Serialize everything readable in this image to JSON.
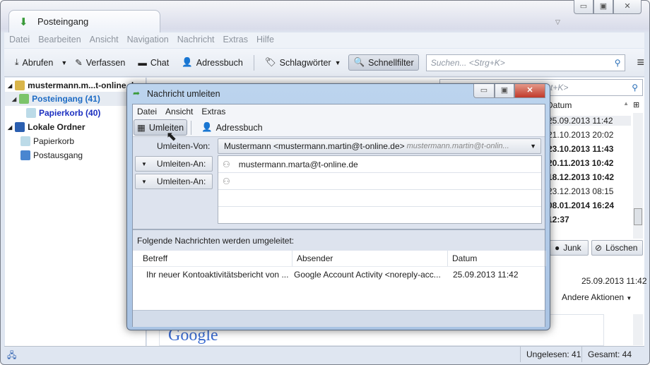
{
  "window": {
    "tab_title": "Posteingang",
    "minimize": "▭",
    "maximize": "▣",
    "close": "✕"
  },
  "menubar": [
    "Datei",
    "Bearbeiten",
    "Ansicht",
    "Navigation",
    "Nachricht",
    "Extras",
    "Hilfe"
  ],
  "toolbar": {
    "abrufen": "Abrufen",
    "verfassen": "Verfassen",
    "chat": "Chat",
    "adressbuch": "Adressbuch",
    "schlagwoerter": "Schlagwörter",
    "schnellfilter": "Schnellfilter",
    "search_placeholder": "Suchen... <Strg+K>"
  },
  "folders": {
    "account": "mustermann.m...t-online.de",
    "posteingang": "Posteingang (41)",
    "papierkorb_acc": "Papierkorb (40)",
    "lokale": "Lokale Ordner",
    "papierkorb": "Papierkorb",
    "postausgang": "Postausgang"
  },
  "list": {
    "search_hint": "t+K>",
    "col_datum": "Datum",
    "dates": [
      {
        "t": "25.09.2013 11:42",
        "b": false
      },
      {
        "t": "21.10.2013 20:02",
        "b": false
      },
      {
        "t": "23.10.2013 11:43",
        "b": true
      },
      {
        "t": "20.11.2013 10:42",
        "b": true
      },
      {
        "t": "18.12.2013 10:42",
        "b": true
      },
      {
        "t": "23.12.2013 08:15",
        "b": false
      },
      {
        "t": "08.01.2014 16:24",
        "b": true
      },
      {
        "t": "12:37",
        "b": true
      }
    ]
  },
  "preview": {
    "junk": "Junk",
    "loeschen": "Löschen",
    "date": "25.09.2013 11:42",
    "andere": "Andere Aktionen",
    "logo": "Google"
  },
  "status": {
    "ungelesen": "Ungelesen: 41",
    "gesamt": "Gesamt: 44"
  },
  "dialog": {
    "title": "Nachricht umleiten",
    "menu": [
      "Datei",
      "Ansicht",
      "Extras"
    ],
    "umleiten": "Umleiten",
    "adressbuch": "Adressbuch",
    "von_label": "Umleiten-Von:",
    "von_value": "Mustermann <mustermann.martin@t-online.de>",
    "von_hint": "mustermann.martin@t-onlin...",
    "an_label": "Umleiten-An:",
    "recipients": [
      "mustermann.marta@t-online.de",
      ""
    ],
    "heading": "Folgende Nachrichten werden umgeleitet:",
    "columns": [
      "Betreff",
      "Absender",
      "Datum"
    ],
    "rows": [
      [
        "Ihr neuer Kontoaktivitätsbericht von ...",
        "Google Account Activity <noreply-acc...",
        "25.09.2013 11:42"
      ]
    ]
  }
}
